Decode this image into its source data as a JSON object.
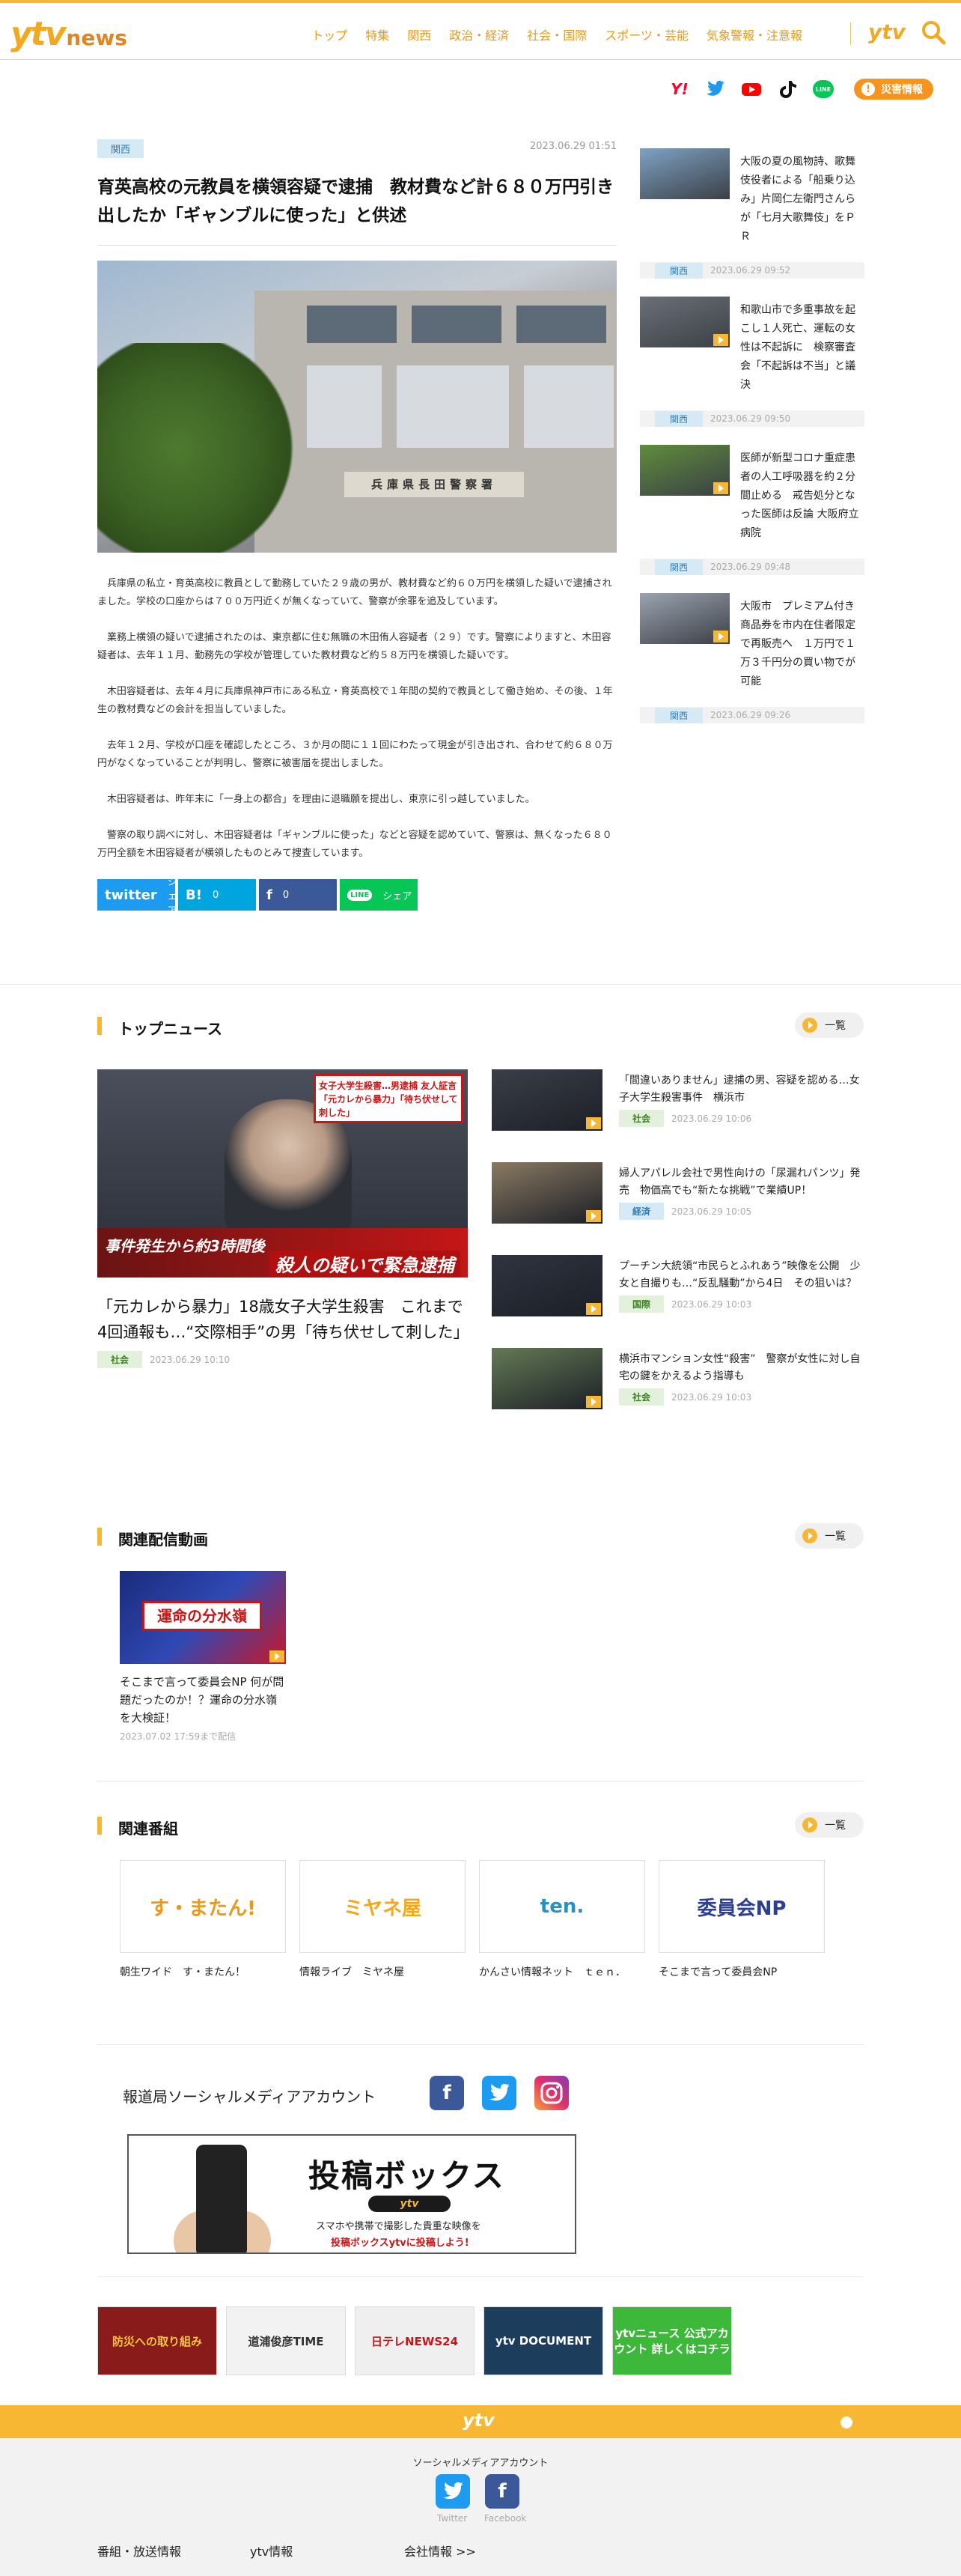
{
  "header": {
    "logo_ytv": "ytv",
    "logo_news": "news",
    "nav": [
      "トップ",
      "特集",
      "関西",
      "政治・経済",
      "社会・国際",
      "スポーツ・芸能",
      "気象警報・注意報"
    ],
    "ytv_logo": "ytv",
    "search_icon": "search-icon"
  },
  "social_top": {
    "icons": [
      "Y!",
      "twitter",
      "youtube",
      "tiktok",
      "LINE"
    ],
    "disaster_label": "災害情報"
  },
  "article": {
    "tag": "関西",
    "date": "2023.06.29 01:51",
    "title": "育英高校の元教員を横領容疑で逮捕　教材費など計６８０万円引き出したか「ギャンブルに使った」と供述",
    "photo_sign": "兵庫県長田警察署",
    "paragraphs": [
      "兵庫県の私立・育英高校に教員として勤務していた２９歳の男が、教材費など約６０万円を横領した疑いで逮捕されました。学校の口座からは７００万円近くが無くなっていて、警察が余罪を追及しています。",
      "業務上横領の疑いで逮捕されたのは、東京都に住む無職の木田侑人容疑者（２９）です。警察によりますと、木田容疑者は、去年１１月、勤務先の学校が管理していた教材費など約５８万円を横領した疑いです。",
      "木田容疑者は、去年４月に兵庫県神戸市にある私立・育英高校で１年間の契約で教員として働き始め、その後、１年生の教材費などの会計を担当していました。",
      "去年１２月、学校が口座を確認したところ、３か月の間に１１回にわたって現金が引き出され、合わせて約６８０万円がなくなっていることが判明し、警察に被害届を提出しました。",
      "木田容疑者は、昨年末に「一身上の都合」を理由に退職願を提出し、東京に引っ越していました。",
      "警察の取り調べに対し、木田容疑者は「ギャンブルに使った」などと容疑を認めていて、警察は、無くなった６８０万円全額を木田容疑者が横領したものとみて捜査しています。"
    ],
    "share": [
      {
        "label": "シェア",
        "icon": "twitter",
        "color": "#1d9bf0"
      },
      {
        "label": "0",
        "icon": "B!",
        "color": "#00a4de"
      },
      {
        "label": "0",
        "icon": "f",
        "color": "#3b5998"
      },
      {
        "label": "シェア",
        "icon": "LINE",
        "color": "#06c755"
      }
    ]
  },
  "side": [
    {
      "title": "大阪の夏の風物詩、歌舞伎役者による「船乗り込み」片岡仁左衛門さんらが「七月大歌舞伎」をＰＲ",
      "tag": "関西",
      "date": "2023.06.29 09:52",
      "color": "#7ea2c4",
      "video": false
    },
    {
      "title": "和歌山市で多重事故を起こし１人死亡、運転の女性は不起訴に　検察審査会「不起訴は不当」と議決",
      "tag": "関西",
      "date": "2023.06.29 09:50",
      "color": "#6b7078",
      "video": true
    },
    {
      "title": "医師が新型コロナ重症患者の人工呼吸器を約２分間止める　戒告処分となった医師は反論 大阪府立病院",
      "tag": "関西",
      "date": "2023.06.29 09:48",
      "color": "#5f8d3b",
      "video": true
    },
    {
      "title": "大阪市　プレミアム付き商品券を市内在住者限定で再販売へ　１万円で１万３千円分の買い物でが可能",
      "tag": "関西",
      "date": "2023.06.29 09:26",
      "color": "#9aa3b0",
      "video": true
    }
  ],
  "top_news": {
    "heading": "トップニュース",
    "more": "一覧",
    "main": {
      "title": "「元カレから暴力」18歳女子大学生殺害　これまで4回通報も…“交際相手”の男「待ち伏せして刺した」",
      "tag": "社会",
      "date": "2023.06.29 10:10",
      "img_cap1": "事件発生から約3時間後",
      "img_cap2": "殺人の疑いで緊急逮捕",
      "img_tel": "女子大学生殺害…男逮捕 友人証言「元カレから暴力」「待ち伏せして刺した」"
    },
    "list": [
      {
        "title": "「間違いありません」逮捕の男、容疑を認める…女子大学生殺害事件　横浜市",
        "tag": "社会",
        "tagType": "green",
        "date": "2023.06.29 10:06",
        "color": "#3a3e47"
      },
      {
        "title": "婦人アパレル会社で男性向けの「尿漏れパンツ」発売　物価高でも“新たな挑戦”で業績UP！",
        "tag": "経済",
        "tagType": "blue",
        "date": "2023.06.29 10:05",
        "color": "#8a7a62"
      },
      {
        "title": "プーチン大統領“市民らとふれあう”映像を公開　少女と自撮りも…“反乱騒動”から4日　その狙いは？",
        "tag": "国際",
        "tagType": "green",
        "date": "2023.06.29 10:03",
        "color": "#2f3440"
      },
      {
        "title": "横浜市マンション女性“殺害”　警察が女性に対し自宅の鍵をかえるよう指導も",
        "tag": "社会",
        "tagType": "green",
        "date": "2023.06.29 10:03",
        "color": "#647a55"
      }
    ]
  },
  "related_video": {
    "heading": "関連配信動画",
    "more": "一覧",
    "title": "そこまで言って委員会NP 何が問題だったのか！？運命の分水嶺を大検証！",
    "img_label": "運命の分水嶺",
    "date": "2023.07.02 17:59まで配信"
  },
  "programs": {
    "heading": "関連番組",
    "more": "一覧",
    "items": [
      {
        "name": "朝生ワイド　す・またん！",
        "logo": "す・またん!",
        "color": "#e89a1d"
      },
      {
        "name": "情報ライブ　ミヤネ屋",
        "logo": "ミヤネ屋",
        "color": "#f3a719"
      },
      {
        "name": "かんさい情報ネット　ｔｅｎ．",
        "logo": "ten.",
        "color": "#2a8fc2"
      },
      {
        "name": "そこまで言って委員会NP",
        "logo": "委員会NP",
        "color": "#2d3f8f"
      }
    ]
  },
  "sns": {
    "title": "報道局ソーシャルメディアアカウント",
    "toko_big": "投稿ボックス",
    "toko_pill": "ytv",
    "toko_s1": "スマホや携帯で撮影した貴重な映像を",
    "toko_s2": "投稿ボックスytvに投稿しよう!"
  },
  "banners": [
    {
      "label": "防災への取り組み",
      "bg": "#8a1b1b",
      "fg": "#f4c542"
    },
    {
      "label": "道浦俊彦TIME",
      "bg": "#f2f2f2",
      "fg": "#333333"
    },
    {
      "label": "日テレNEWS24",
      "bg": "#efefef",
      "fg": "#c81515"
    },
    {
      "label": "ytv DOCUMENT",
      "bg": "#1d3d5c",
      "fg": "#ffffff"
    },
    {
      "label": "ytvニュース 公式アカウント 詳しくはコチラ",
      "bg": "#3db83a",
      "fg": "#ffffff"
    }
  ],
  "footer": {
    "logo": "ytv",
    "social_label": "ソーシャルメディアアカウント",
    "twitter": "Twitter",
    "facebook": "Facebook",
    "links": [
      "番組・放送情報",
      "ytv情報",
      "会社情報 >>"
    ]
  }
}
